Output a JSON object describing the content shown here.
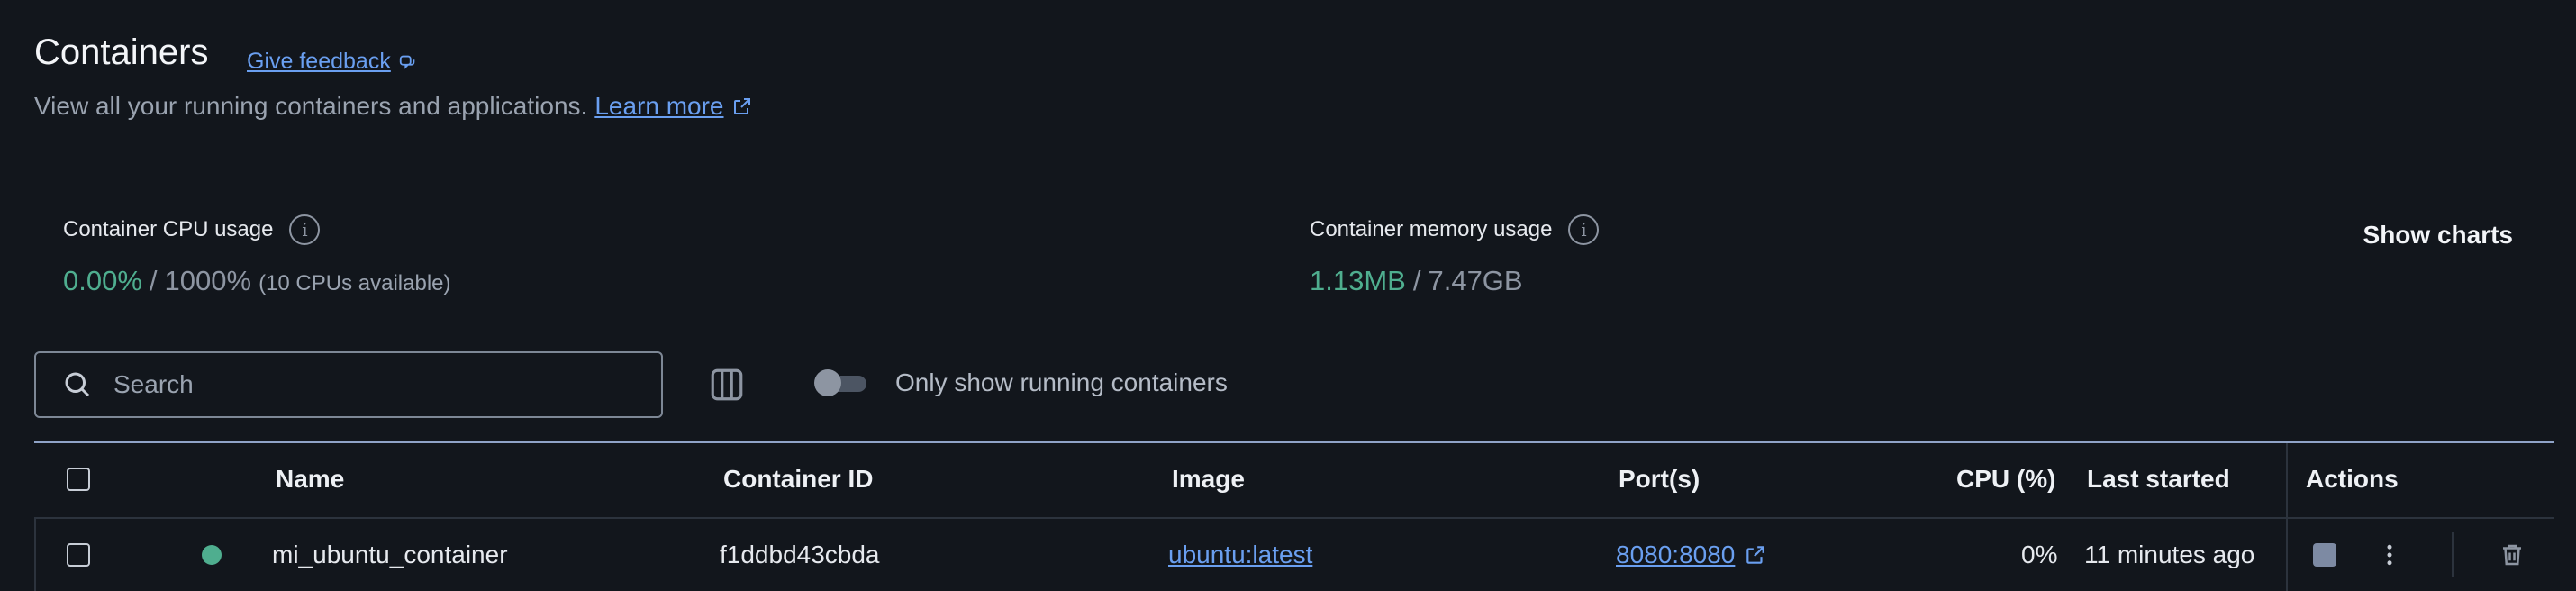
{
  "header": {
    "title": "Containers",
    "feedback_label": "Give feedback",
    "subtitle": "View all your running containers and applications.",
    "learn_more": "Learn more"
  },
  "stats": {
    "cpu": {
      "label": "Container CPU usage",
      "used": "0.00%",
      "separator": "/",
      "total": "1000%",
      "note": "(10 CPUs available)"
    },
    "memory": {
      "label": "Container memory usage",
      "used": "1.13MB",
      "separator": "/",
      "total": "7.47GB"
    },
    "show_charts": "Show charts"
  },
  "toolbar": {
    "search_placeholder": "Search",
    "toggle_label": "Only show running containers",
    "toggle_on": false
  },
  "table": {
    "columns": [
      "Name",
      "Container ID",
      "Image",
      "Port(s)",
      "CPU (%)",
      "Last started",
      "Actions"
    ],
    "rows": [
      {
        "status": "running",
        "name": "mi_ubuntu_container",
        "container_id": "f1ddbd43cbda",
        "image": "ubuntu:latest",
        "ports": "8080:8080",
        "cpu": "0%",
        "last_started": "11 minutes ago"
      }
    ]
  },
  "colors": {
    "background": "#12161c",
    "accent_link": "#6a9ff0",
    "status_running": "#4fae8f"
  },
  "icons": {
    "feedback": "feedback-icon",
    "external": "external-link-icon",
    "info": "info-icon",
    "search": "search-icon",
    "columns": "columns-icon",
    "stop": "stop-icon",
    "more": "more-vertical-icon",
    "delete": "trash-icon"
  }
}
